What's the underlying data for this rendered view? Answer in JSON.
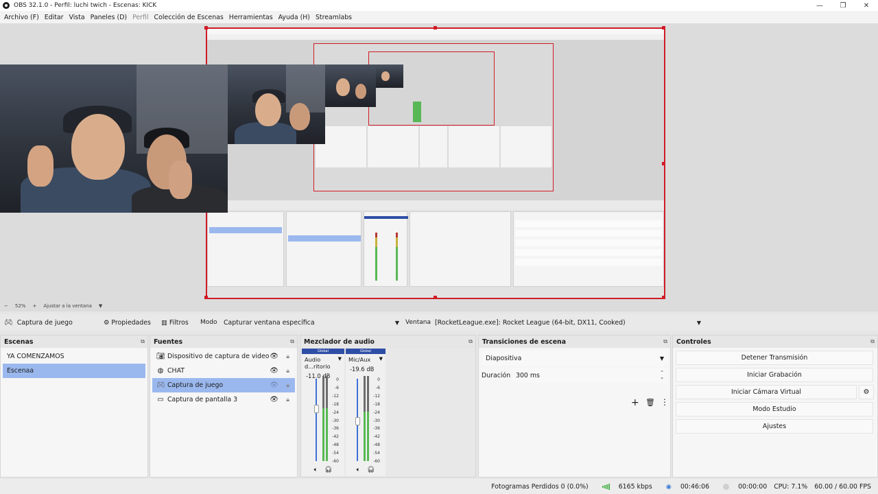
{
  "window": {
    "title": "OBS 32.1.0 - Perfil: luchi twich - Escenas: KICK",
    "controls": [
      "—",
      "❐",
      "✕"
    ]
  },
  "menu": [
    "Archivo (F)",
    "Editar",
    "Vista",
    "Paneles (D)",
    "Perfil",
    "Colección de Escenas",
    "Herramientas",
    "Ayuda (H)",
    "Streamlabs"
  ],
  "zoom": {
    "level": "52%",
    "fit_label": "Ajustar a la ventana"
  },
  "source_toolbar": {
    "source_name": "Captura de juego",
    "properties": "Propiedades",
    "filters": "Filtros",
    "mode_label": "Modo",
    "mode_value": "Capturar ventana específica",
    "window_label": "Ventana",
    "window_value": "[RocketLeague.exe]: Rocket League (64-bit, DX11, Cooked)"
  },
  "scenes": {
    "title": "Escenas",
    "items": [
      "YA COMENZAMOS",
      "Escenaa"
    ],
    "selected_index": 1
  },
  "sources": {
    "title": "Fuentes",
    "items": [
      {
        "icon": "camera-icon",
        "label": "Dispositivo de captura de video"
      },
      {
        "icon": "browser-icon",
        "label": "CHAT"
      },
      {
        "icon": "gamepad-icon",
        "label": "Captura de juego"
      },
      {
        "icon": "monitor-icon",
        "label": "Captura de pantalla 3"
      }
    ],
    "selected_index": 2
  },
  "mixer": {
    "title": "Mezclador de audio",
    "channels": [
      {
        "top": "Global",
        "name": "Audio d...ritorio",
        "db": "-11.0 dB",
        "level": 0.62
      },
      {
        "top": "Global",
        "name": "Mic/Aux",
        "db": "-19.6 dB",
        "level": 0.58
      }
    ],
    "scale": [
      "0",
      "-6",
      "-12",
      "-18",
      "-24",
      "-30",
      "-36",
      "-42",
      "-48",
      "-54",
      "-60"
    ]
  },
  "transitions": {
    "title": "Transiciones de escena",
    "type": "Diapositiva",
    "duration_label": "Duración",
    "duration_value": "300 ms"
  },
  "controls": {
    "title": "Controles",
    "buttons": [
      "Detener Transmisión",
      "Iniciar Grabación",
      "Iniciar Cámara Virtual",
      "Modo Estudio",
      "Ajustes"
    ]
  },
  "status": {
    "dropped": "Fotogramas Perdidos 0 (0.0%)",
    "bitrate": "6165 kbps",
    "stream_time": "00:46:06",
    "rec_time": "00:00:00",
    "cpu": "CPU: 7.1%",
    "fps": "60.00 / 60.00 FPS"
  },
  "colors": {
    "selection": "#9bb8ee",
    "preview_border": "#d01b26",
    "mixer_header": "#2e4ea6"
  }
}
